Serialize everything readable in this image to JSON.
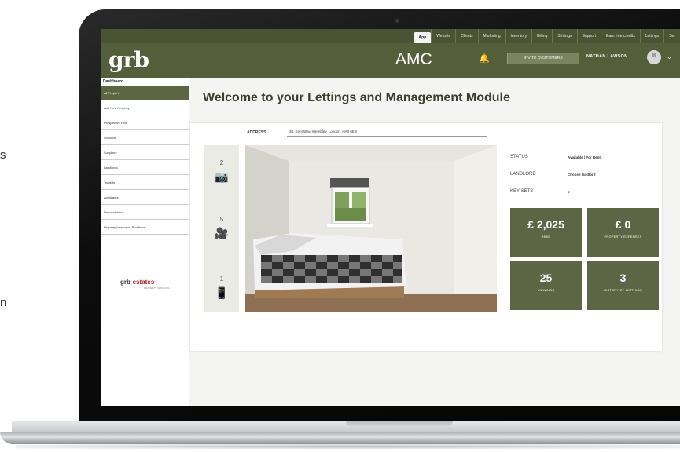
{
  "side_texts": [
    "s",
    "n"
  ],
  "topnav": {
    "tabs": [
      "App",
      "Website",
      "Clients",
      "Marketing",
      "Inventory",
      "Billing",
      "Settings",
      "Support",
      "Earn free credits",
      "Lettings",
      "Ser"
    ],
    "active_index": 0
  },
  "header": {
    "logo": "grb",
    "brand": "AMC",
    "invite_label": "INVITE CUSTOMERS",
    "user_name": "NATHAN LAWSON",
    "caret": "⌄"
  },
  "sidebar": {
    "title": "Dashboard",
    "items": [
      {
        "label": "All Property",
        "active": true
      },
      {
        "label": "Add New Property",
        "active": false
      },
      {
        "label": "Prospective Lets",
        "active": false
      },
      {
        "label": "Contacts",
        "active": false
      },
      {
        "label": "Suppliers",
        "active": false
      },
      {
        "label": "Landlords",
        "active": false
      },
      {
        "label": "Tenants",
        "active": false
      },
      {
        "label": "Applicants",
        "active": false
      },
      {
        "label": "Reconciliation",
        "active": false
      },
      {
        "label": "Property Inspection Problems",
        "active": false
      }
    ],
    "logo_main": "grb",
    "logo_accent": "estates",
    "logo_sub": "PROPERTY SERVICES"
  },
  "main": {
    "welcome": "Welcome to your  Lettings and Management Module",
    "address_label": "ADDRESS",
    "address_value": "38, Kent Way, Wembley, London, HA0 6EB",
    "media": [
      {
        "count": "2",
        "icon": "camera-icon",
        "glyph": "📷"
      },
      {
        "count": "5",
        "icon": "video-camera-icon",
        "glyph": "🎥"
      },
      {
        "count": "1",
        "icon": "phone-icon",
        "glyph": "📱"
      }
    ],
    "details": [
      {
        "label": "STATUS",
        "value": "Available / For Rent"
      },
      {
        "label": "LANDLORD",
        "value": "Choose landlord"
      },
      {
        "label": "KEY SETS",
        "value": "0"
      }
    ],
    "tiles": [
      {
        "value": "£ 2,025",
        "label": "RENT"
      },
      {
        "value": "£ 0",
        "label": "PROPERTY EXPENSES"
      },
      {
        "value": "25",
        "label": "VIEWINGS"
      },
      {
        "value": "3",
        "label": "HISTORY OF LETTINGS"
      }
    ]
  },
  "colors": {
    "brand_green": "#555e3b",
    "tile_green": "#5c6544",
    "accent_red": "#a3262a"
  }
}
